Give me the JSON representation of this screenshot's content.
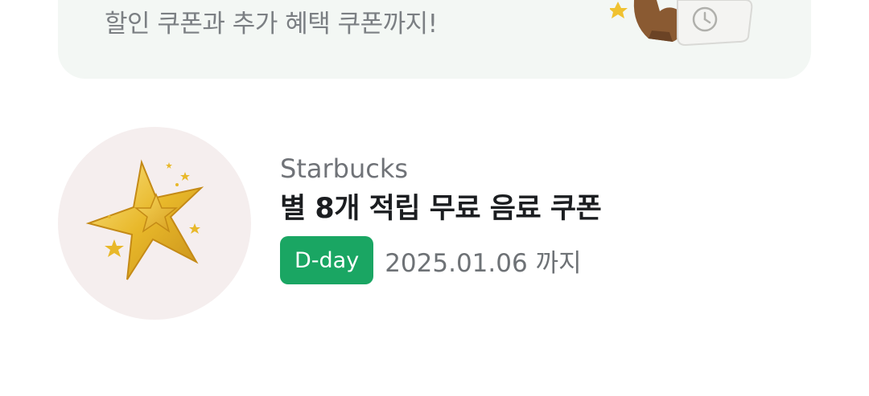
{
  "promo": {
    "text": "할인 쿠폰과 추가 혜택 쿠폰까지!",
    "illustration_icon": "coupon-clock-illustration"
  },
  "coupon": {
    "thumb_icon": "gold-star-icon",
    "brand": "Starbucks",
    "title": "별 8개 적립 무료 음료 쿠폰",
    "badge": "D-day",
    "expiry": "2025.01.06 까지"
  },
  "colors": {
    "badge_bg": "#1aa663",
    "thumb_bg": "#f5eeee",
    "banner_bg": "#f3f7f4",
    "star_gold": "#e8b82a"
  }
}
